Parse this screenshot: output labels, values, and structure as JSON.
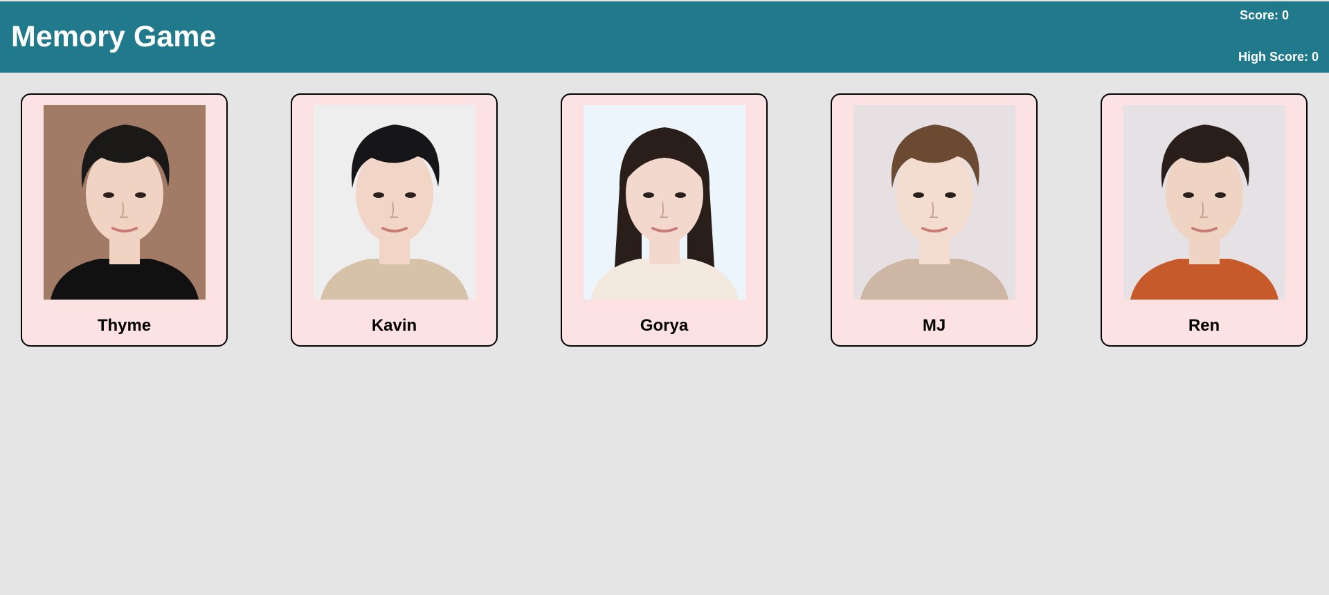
{
  "header": {
    "title": "Memory Game",
    "score_label": "Score: 0",
    "high_score_label": "High Score: 0"
  },
  "cards": [
    {
      "name": "Thyme",
      "bg": "#a27b66",
      "hair": "#1b1918",
      "skin": "#f0d3c2",
      "shirt": "#111111"
    },
    {
      "name": "Kavin",
      "bg": "#eeeeef",
      "hair": "#161618",
      "skin": "#f1d6c7",
      "shirt": "#d6c2a9"
    },
    {
      "name": "Gorya",
      "bg": "#ecf5fb",
      "hair": "#2a1e1a",
      "skin": "#f3d9cd",
      "shirt": "#f3e9df"
    },
    {
      "name": "MJ",
      "bg": "#e6e0e2",
      "hair": "#6b4a31",
      "skin": "#f3dcd0",
      "shirt": "#cdb6a3"
    },
    {
      "name": "Ren",
      "bg": "#e5e1e4",
      "hair": "#2a1e1b",
      "skin": "#f0d4c3",
      "shirt": "#c65a2a"
    }
  ],
  "colors": {
    "header_bg": "#217a8b",
    "page_bg": "#e5e5e5",
    "card_bg": "#fde2e4"
  }
}
